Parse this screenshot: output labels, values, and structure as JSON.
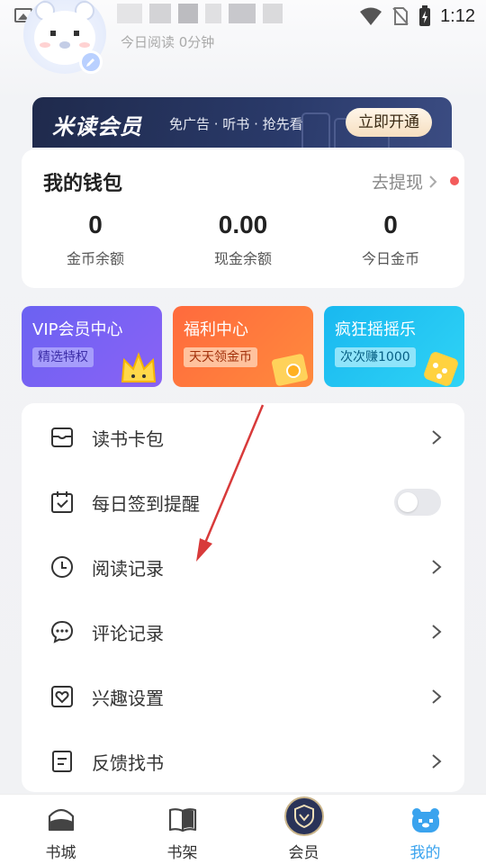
{
  "status_bar": {
    "time": "1:12"
  },
  "profile": {
    "read_today": "今日阅读 0分钟"
  },
  "vip_banner": {
    "title": "米读会员",
    "subtitle": "免广告 · 听书 · 抢先看",
    "button": "立即开通"
  },
  "wallet": {
    "title": "我的钱包",
    "withdraw": "去提现",
    "stats": [
      {
        "value": "0",
        "label": "金币余额"
      },
      {
        "value": "0.00",
        "label": "现金余额"
      },
      {
        "value": "0",
        "label": "今日金币"
      }
    ]
  },
  "cards": [
    {
      "title": "VIP会员中心",
      "tag": "精选特权"
    },
    {
      "title": "福利中心",
      "tag": "天天领金币"
    },
    {
      "title": "疯狂摇摇乐",
      "tag": "次次赚1000"
    }
  ],
  "menu": [
    {
      "label": "读书卡包",
      "icon": "card-wallet-icon",
      "control": "chevron"
    },
    {
      "label": "每日签到提醒",
      "icon": "calendar-check-icon",
      "control": "toggle",
      "toggle_on": false
    },
    {
      "label": "阅读记录",
      "icon": "clock-icon",
      "control": "chevron"
    },
    {
      "label": "评论记录",
      "icon": "comment-icon",
      "control": "chevron"
    },
    {
      "label": "兴趣设置",
      "icon": "heart-icon",
      "control": "chevron"
    },
    {
      "label": "反馈找书",
      "icon": "document-icon",
      "control": "chevron"
    }
  ],
  "bottom_nav": [
    {
      "label": "书城",
      "icon": "bookstore-icon",
      "active": false
    },
    {
      "label": "书架",
      "icon": "bookshelf-icon",
      "active": false
    },
    {
      "label": "会员",
      "icon": "vip-shield-icon",
      "active": false
    },
    {
      "label": "我的",
      "icon": "profile-bear-icon",
      "active": true
    }
  ],
  "colors": {
    "accent": "#3aa3ee",
    "vip_banner": "#1f2a4c",
    "red_dot": "#f35b5b",
    "annotation_arrow": "#d83a3a"
  }
}
